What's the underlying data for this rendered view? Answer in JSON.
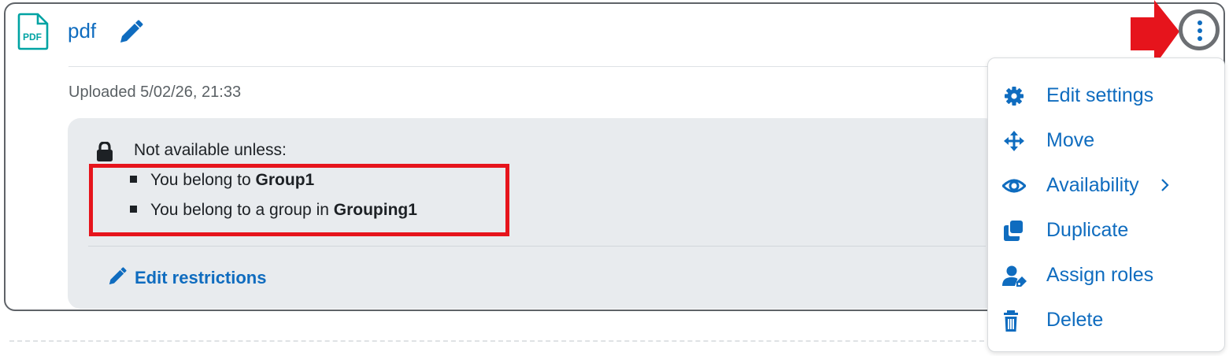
{
  "activity": {
    "title": "pdf",
    "icon": "pdf-file-icon",
    "icon_label": "PDF",
    "uploaded": "Uploaded 5/02/26, 21:33"
  },
  "restrictions": {
    "heading": "Not available unless:",
    "conditions": [
      {
        "prefix": "You belong to ",
        "value": "Group1"
      },
      {
        "prefix": "You belong to a group in ",
        "value": "Grouping1"
      }
    ],
    "edit_label": "Edit restrictions"
  },
  "menu": {
    "items": [
      {
        "label": "Edit settings",
        "icon": "gear-icon"
      },
      {
        "label": "Move",
        "icon": "move-arrows-icon"
      },
      {
        "label": "Availability",
        "icon": "eye-icon",
        "submenu": true
      },
      {
        "label": "Duplicate",
        "icon": "duplicate-icon"
      },
      {
        "label": "Assign roles",
        "icon": "assign-roles-icon"
      },
      {
        "label": "Delete",
        "icon": "trash-icon"
      }
    ]
  },
  "colors": {
    "link": "#0f6cbf",
    "highlight": "#e6141c",
    "restriction_bg": "#e8ebee",
    "pdf_icon": "#00a3a3"
  }
}
